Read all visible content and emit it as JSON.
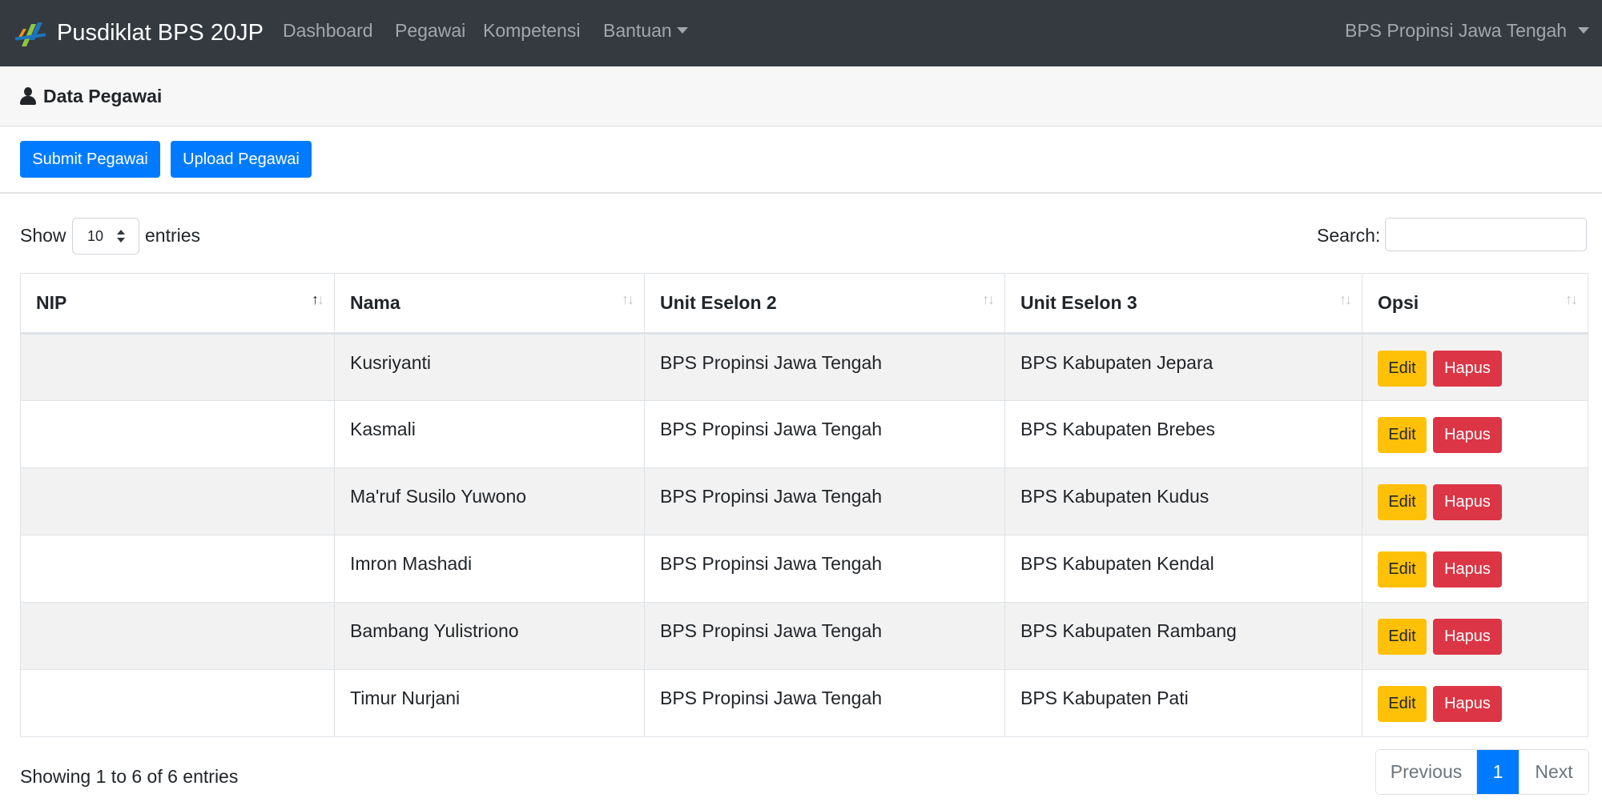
{
  "navbar": {
    "brand": "Pusdiklat BPS 20JP",
    "links": [
      "Dashboard",
      "Pegawai",
      "Kompetensi",
      "Bantuan"
    ],
    "user_menu": "BPS Propinsi Jawa Tengah"
  },
  "page": {
    "title": "Data Pegawai",
    "submit_button": "Submit Pegawai",
    "upload_button": "Upload Pegawai"
  },
  "table_controls": {
    "show_label": "Show",
    "length_value": "10",
    "entries_label": "entries",
    "search_label": "Search:",
    "search_value": ""
  },
  "table": {
    "columns": [
      "NIP",
      "Nama",
      "Unit Eselon 2",
      "Unit Eselon 3",
      "Opsi"
    ],
    "rows": [
      {
        "nip": "",
        "nama": "Kusriyanti",
        "eselon2": "BPS Propinsi Jawa Tengah",
        "eselon3": "BPS Kabupaten Jepara"
      },
      {
        "nip": "",
        "nama": "Kasmali",
        "eselon2": "BPS Propinsi Jawa Tengah",
        "eselon3": "BPS Kabupaten Brebes"
      },
      {
        "nip": "",
        "nama": "Ma'ruf Susilo Yuwono",
        "eselon2": "BPS Propinsi Jawa Tengah",
        "eselon3": "BPS Kabupaten Kudus"
      },
      {
        "nip": "",
        "nama": "Imron Mashadi",
        "eselon2": "BPS Propinsi Jawa Tengah",
        "eselon3": "BPS Kabupaten Kendal"
      },
      {
        "nip": "",
        "nama": "Bambang Yulistriono",
        "eselon2": "BPS Propinsi Jawa Tengah",
        "eselon3": "BPS Kabupaten Rambang"
      },
      {
        "nip": "",
        "nama": "Timur Nurjani",
        "eselon2": "BPS Propinsi Jawa Tengah",
        "eselon3": "BPS Kabupaten Pati"
      }
    ],
    "edit_label": "Edit",
    "delete_label": "Hapus"
  },
  "footer": {
    "info": "Showing 1 to 6 of 6 entries",
    "previous": "Previous",
    "current_page": "1",
    "next": "Next"
  },
  "colors": {
    "navbar_bg": "#343a40",
    "primary": "#007bff",
    "warning": "#ffc107",
    "danger": "#dc3545"
  }
}
